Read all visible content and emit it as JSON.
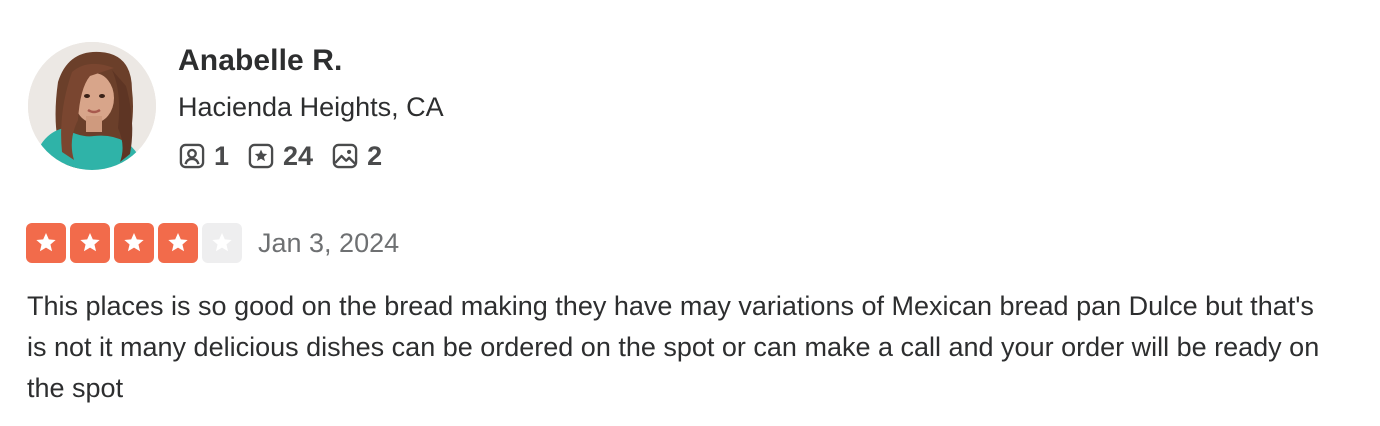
{
  "user": {
    "name": "Anabelle R.",
    "location": "Hacienda Heights, CA",
    "stats": {
      "friends": "1",
      "reviews": "24",
      "photos": "2"
    }
  },
  "icons": {
    "friends": "friends-icon",
    "reviews": "review-star-icon",
    "photos": "photo-icon"
  },
  "review": {
    "rating": 4,
    "rating_max": 5,
    "date": "Jan 3, 2024",
    "text": "This places is so good on the bread making they have may variations of Mexican bread pan Dulce but that's is not it many delicious dishes can be ordered on the spot or can make a call and your order will be ready on the spot"
  },
  "colors": {
    "star_filled": "#f26b4b",
    "star_empty": "#eeeeef",
    "text": "#2d2e2f",
    "muted": "#6e7072"
  }
}
